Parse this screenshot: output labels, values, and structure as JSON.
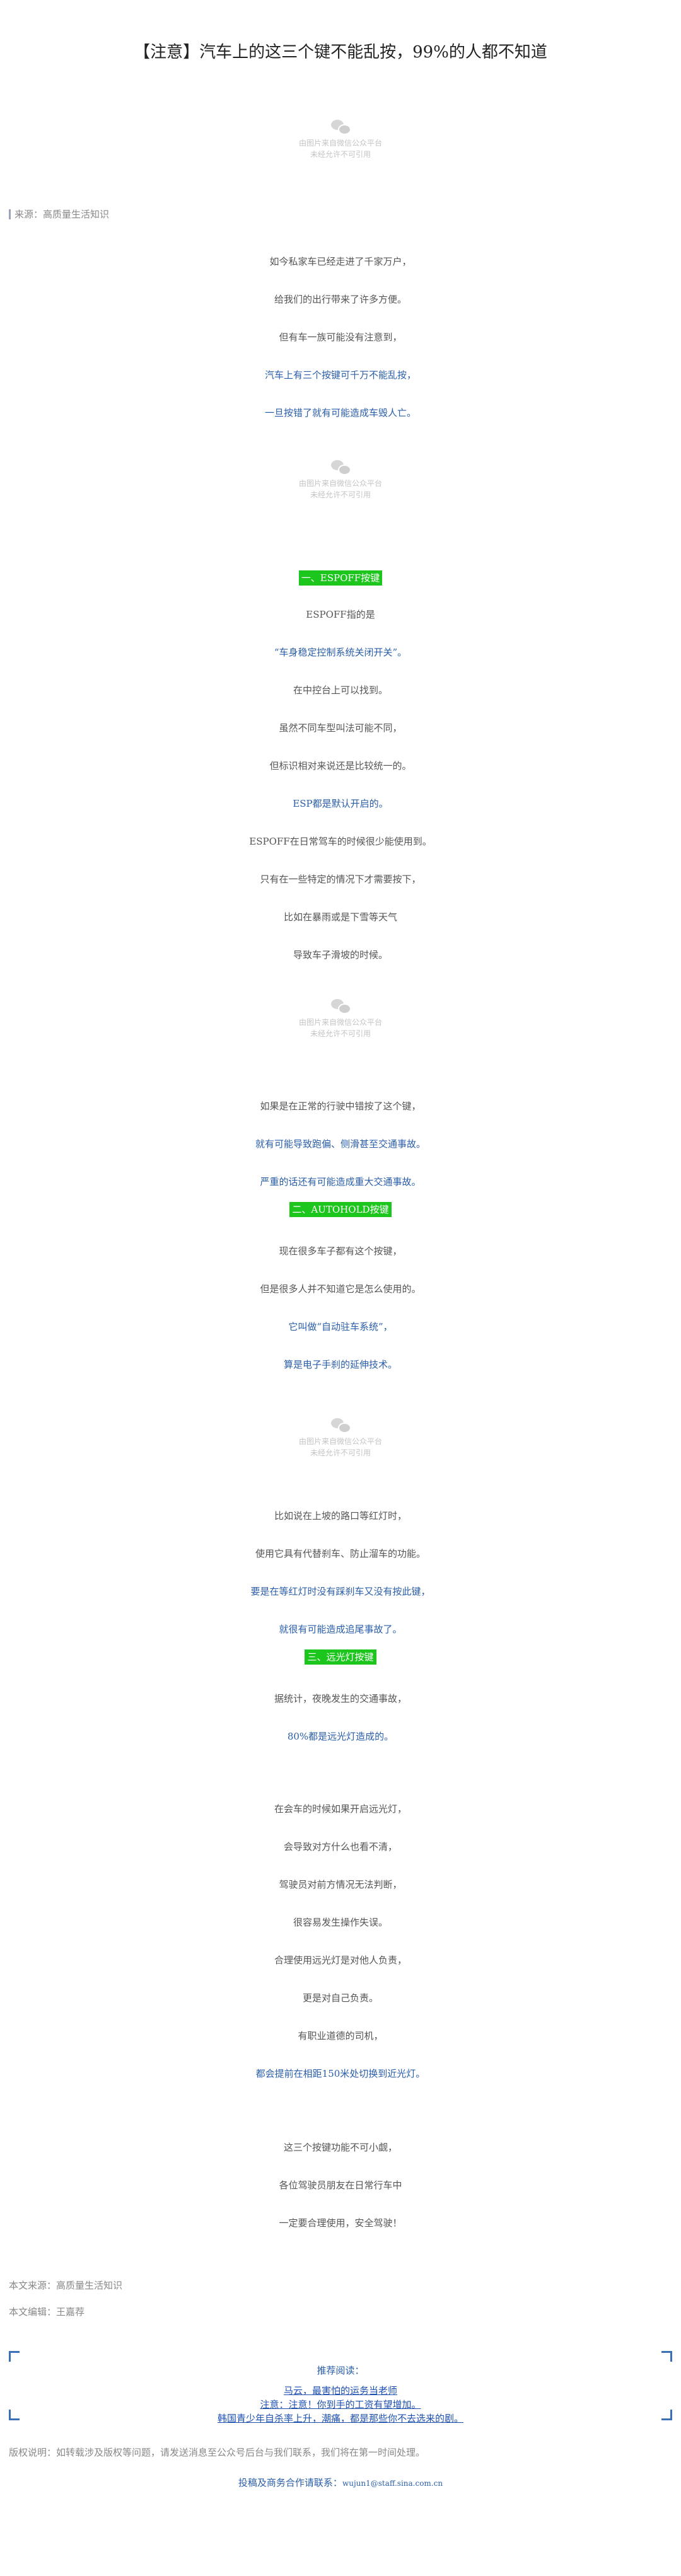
{
  "title": "【注意】汽车上的这三个键不能乱按，99%的人都不知道",
  "image_placeholder": {
    "caption_line1": "由图片来自微信公众平台",
    "caption_line2": "未经允许不可引用"
  },
  "source_top": "来源：高质量生活知识",
  "paragraphs": [
    {
      "text": "如今私家车已经走进了千家万户，",
      "blue": false
    },
    {
      "text": "给我们的出行带来了许多方便。",
      "blue": false
    },
    {
      "text": "但有车一族可能没有注意到，",
      "blue": false
    },
    {
      "text": "汽车上有三个按键可千万不能乱按，",
      "blue": true
    },
    {
      "text": "一旦按错了就有可能造成车毁人亡。",
      "blue": true
    }
  ],
  "section1": {
    "heading": "一、ESPOFF按键",
    "paragraphs": [
      {
        "text": "ESPOFF指的是",
        "blue": false
      },
      {
        "text": "“车身稳定控制系统关闭开关”。",
        "blue": true
      },
      {
        "text": "在中控台上可以找到。",
        "blue": false
      },
      {
        "text": "虽然不同车型叫法可能不同，",
        "blue": false
      },
      {
        "text": "但标识相对来说还是比较统一的。",
        "blue": false
      },
      {
        "text": "ESP都是默认开启的。",
        "blue": true
      },
      {
        "text": "ESPOFF在日常驾车的时候很少能使用到。",
        "blue": false
      },
      {
        "text": "只有在一些特定的情况下才需要按下，",
        "blue": false
      },
      {
        "text": "比如在暴雨或是下雪等天气",
        "blue": false
      },
      {
        "text": "导致车子滑坡的时候。",
        "blue": false
      }
    ],
    "after_image": [
      {
        "text": "如果是在正常的行驶中错按了这个键，",
        "blue": false
      },
      {
        "text": "就有可能导致跑偏、侧滑甚至交通事故。",
        "blue": true
      },
      {
        "text": "严重的话还有可能造成重大交通事故。",
        "blue": true
      }
    ]
  },
  "section2": {
    "heading": "二、AUTOHOLD按键",
    "paragraphs": [
      {
        "text": "现在很多车子都有这个按键，",
        "blue": false
      },
      {
        "text": "但是很多人并不知道它是怎么使用的。",
        "blue": false
      },
      {
        "text": "它叫做“自动驻车系统”，",
        "blue": true
      },
      {
        "text": "算是电子手刹的延伸技术。",
        "blue": true
      }
    ],
    "after_image": [
      {
        "text": "比如说在上坡的路口等红灯时，",
        "blue": false
      },
      {
        "text": "使用它具有代替刹车、防止溜车的功能。",
        "blue": false
      },
      {
        "text": "要是在等红灯时没有踩刹车又没有按此键，",
        "blue": true
      },
      {
        "text": "就很有可能造成追尾事故了。",
        "blue": true
      }
    ]
  },
  "section3": {
    "heading": "三、远光灯按键",
    "paragraphs": [
      {
        "text": "据统计，夜晚发生的交通事故，",
        "blue": false
      },
      {
        "text": "80%都是远光灯造成的。",
        "blue": true
      }
    ],
    "more": [
      {
        "text": "在会车的时候如果开启远光灯，",
        "blue": false
      },
      {
        "text": "会导致对方什么也看不清，",
        "blue": false
      },
      {
        "text": "驾驶员对前方情况无法判断，",
        "blue": false
      },
      {
        "text": "很容易发生操作失误。",
        "blue": false
      },
      {
        "text": "合理使用远光灯是对他人负责，",
        "blue": false
      },
      {
        "text": "更是对自己负责。",
        "blue": false
      },
      {
        "text": "有职业道德的司机，",
        "blue": false
      },
      {
        "text": "都会提前在相距150米处切换到近光灯。",
        "blue": true
      }
    ]
  },
  "closing": [
    {
      "text": "这三个按键功能不可小觑，",
      "blue": false
    },
    {
      "text": "各位驾驶员朋友在日常行车中",
      "blue": false
    },
    {
      "text": "一定要合理使用，安全驾驶！",
      "blue": false
    }
  ],
  "meta": {
    "source": "本文来源：高质量生活知识",
    "editor": "本文编辑：王嘉荐"
  },
  "recommend": {
    "title": "推荐阅读：",
    "links": [
      "马云，最害怕的运务当老师",
      "注意：注意！你到手的工资有望增加。",
      "韩国青少年自杀率上升，潮痛，都是那些你不去选来的剧。"
    ]
  },
  "copyright": "版权说明：如转载涉及版权等问题，请发送消息至公众号后台与我们联系，我们将在第一时间处理。",
  "contact": {
    "label": "投稿及商务合作请联系：",
    "email": "wujun1@staff.sina.com.cn"
  }
}
